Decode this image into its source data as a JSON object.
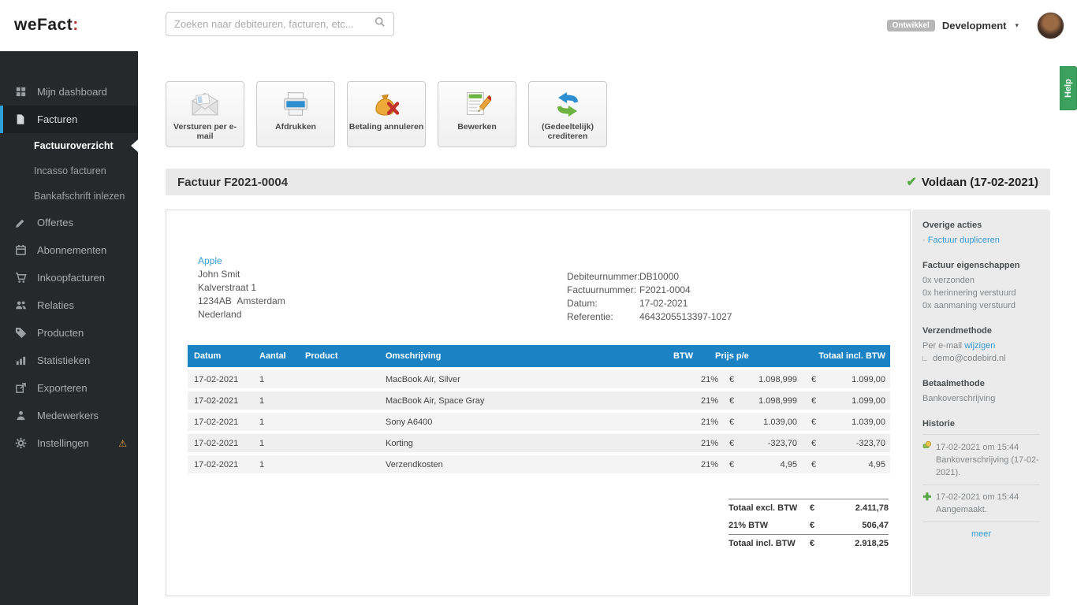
{
  "topbar": {
    "logo_text": "weFact",
    "logo_colon": ":",
    "search_placeholder": "Zoeken naar debiteuren, facturen, etc...",
    "env_badge": "Ontwikkel",
    "env_menu": "Development",
    "caret": "▾"
  },
  "help_tab": {
    "label": "Help"
  },
  "sidebar": {
    "items": [
      {
        "label": "Mijn dashboard"
      },
      {
        "label": "Facturen"
      },
      {
        "label": "Factuuroverzicht"
      },
      {
        "label": "Incasso facturen"
      },
      {
        "label": "Bankafschrift inlezen"
      },
      {
        "label": "Offertes"
      },
      {
        "label": "Abonnementen"
      },
      {
        "label": "Inkoopfacturen"
      },
      {
        "label": "Relaties"
      },
      {
        "label": "Producten"
      },
      {
        "label": "Statistieken"
      },
      {
        "label": "Exporteren"
      },
      {
        "label": "Medewerkers"
      },
      {
        "label": "Instellingen"
      }
    ]
  },
  "toolbar": {
    "buttons": [
      {
        "label": "Versturen per e-mail",
        "icon": "email-icon"
      },
      {
        "label": "Afdrukken",
        "icon": "printer-icon"
      },
      {
        "label": "Betaling annuleren",
        "icon": "cancel-payment-icon"
      },
      {
        "label": "Bewerken",
        "icon": "edit-icon"
      },
      {
        "label": "(Gedeeltelijk) crediteren",
        "icon": "credit-icon"
      }
    ]
  },
  "invoice_bar": {
    "title": "Factuur F2021-0004",
    "check": "✔",
    "status": "Voldaan (17-02-2021)"
  },
  "invoice": {
    "customer": {
      "name": "Apple",
      "lines": [
        "John Smit",
        "Kalverstraat 1",
        "1234AB  Amsterdam",
        "Nederland"
      ]
    },
    "meta": [
      {
        "label": "Debiteurnummer:",
        "value": "DB10000"
      },
      {
        "label": "Factuurnummer:",
        "value": "F2021-0004"
      },
      {
        "label": "Datum:",
        "value": "17-02-2021"
      },
      {
        "label": "Referentie:",
        "value": "4643205513397-1027"
      }
    ],
    "table": {
      "headers": [
        "Datum",
        "Aantal",
        "Product",
        "Omschrijving",
        "BTW",
        "Prijs p/e",
        "Totaal incl. BTW"
      ],
      "currency": "€",
      "rows": [
        {
          "datum": "17-02-2021",
          "aantal": "1",
          "product": "",
          "omschrijving": "MacBook Air, Silver",
          "btw": "21%",
          "prijs": "1.098,999",
          "totaal": "1.099,00"
        },
        {
          "datum": "17-02-2021",
          "aantal": "1",
          "product": "",
          "omschrijving": "MacBook Air, Space Gray",
          "btw": "21%",
          "prijs": "1.098,999",
          "totaal": "1.099,00"
        },
        {
          "datum": "17-02-2021",
          "aantal": "1",
          "product": "",
          "omschrijving": "Sony A6400",
          "btw": "21%",
          "prijs": "1.039,00",
          "totaal": "1.039,00"
        },
        {
          "datum": "17-02-2021",
          "aantal": "1",
          "product": "",
          "omschrijving": "Korting",
          "btw": "21%",
          "prijs": "-323,70",
          "totaal": "-323,70"
        },
        {
          "datum": "17-02-2021",
          "aantal": "1",
          "product": "",
          "omschrijving": "Verzendkosten",
          "btw": "21%",
          "prijs": "4,95",
          "totaal": "4,95"
        }
      ]
    },
    "totals": [
      {
        "label": "Totaal excl. BTW",
        "currency": "€",
        "value": "2.411,78"
      },
      {
        "label": "21% BTW",
        "currency": "€",
        "value": "506,47"
      },
      {
        "label": "Totaal incl. BTW",
        "currency": "€",
        "value": "2.918,25"
      }
    ]
  },
  "panel": {
    "overige_title": "Overige acties",
    "overige_bullet": "·",
    "overige_link": "Factuur dupliceren",
    "eigenschappen_title": "Factuur eigenschappen",
    "eigenschappen": [
      "0x verzonden",
      "0x herinnering verstuurd",
      "0x aanmaning verstuurd"
    ],
    "verzend_title": "Verzendmethode",
    "verzend_value": "Per e-mail",
    "verzend_link": "wijzigen",
    "verzend_email": "demo@codebird.nl",
    "betaal_title": "Betaalmethode",
    "betaal_value": "Bankoverschrijving",
    "historie_title": "Historie",
    "history": [
      {
        "date": "17-02-2021 om 15:44",
        "text": "Bankoverschrijving (17-02-2021)."
      },
      {
        "date": "17-02-2021 om 15:44",
        "text": "Aangemaakt."
      }
    ],
    "more_link": "meer"
  },
  "colors": {
    "accent_blue": "#1b82c4",
    "link_blue": "#3a9bd5",
    "success_green": "#57a847",
    "help_green": "#3ca15c",
    "warning_orange": "#e8a33d"
  }
}
